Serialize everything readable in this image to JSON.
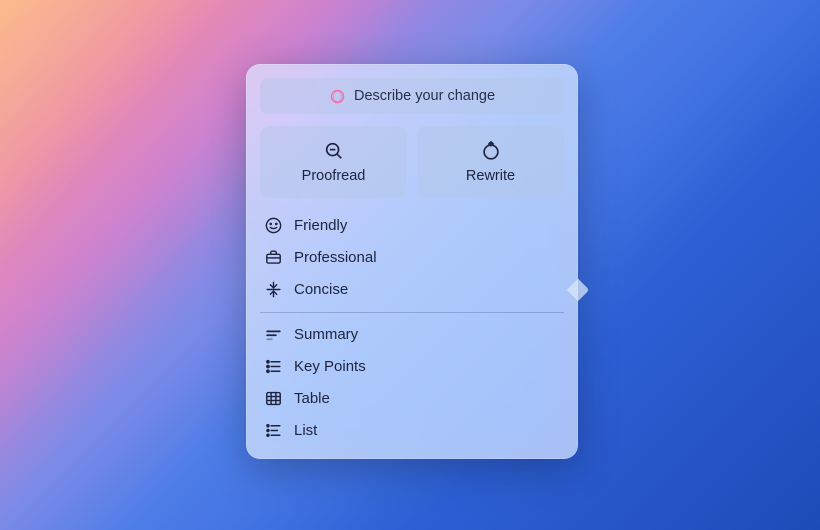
{
  "describe": {
    "placeholder": "Describe your change"
  },
  "actions": {
    "proofread": {
      "label": "Proofread"
    },
    "rewrite": {
      "label": "Rewrite"
    }
  },
  "tones": {
    "friendly": {
      "label": "Friendly"
    },
    "professional": {
      "label": "Professional"
    },
    "concise": {
      "label": "Concise"
    }
  },
  "formats": {
    "summary": {
      "label": "Summary"
    },
    "keypoints": {
      "label": "Key Points"
    },
    "table": {
      "label": "Table"
    },
    "list": {
      "label": "List"
    }
  }
}
